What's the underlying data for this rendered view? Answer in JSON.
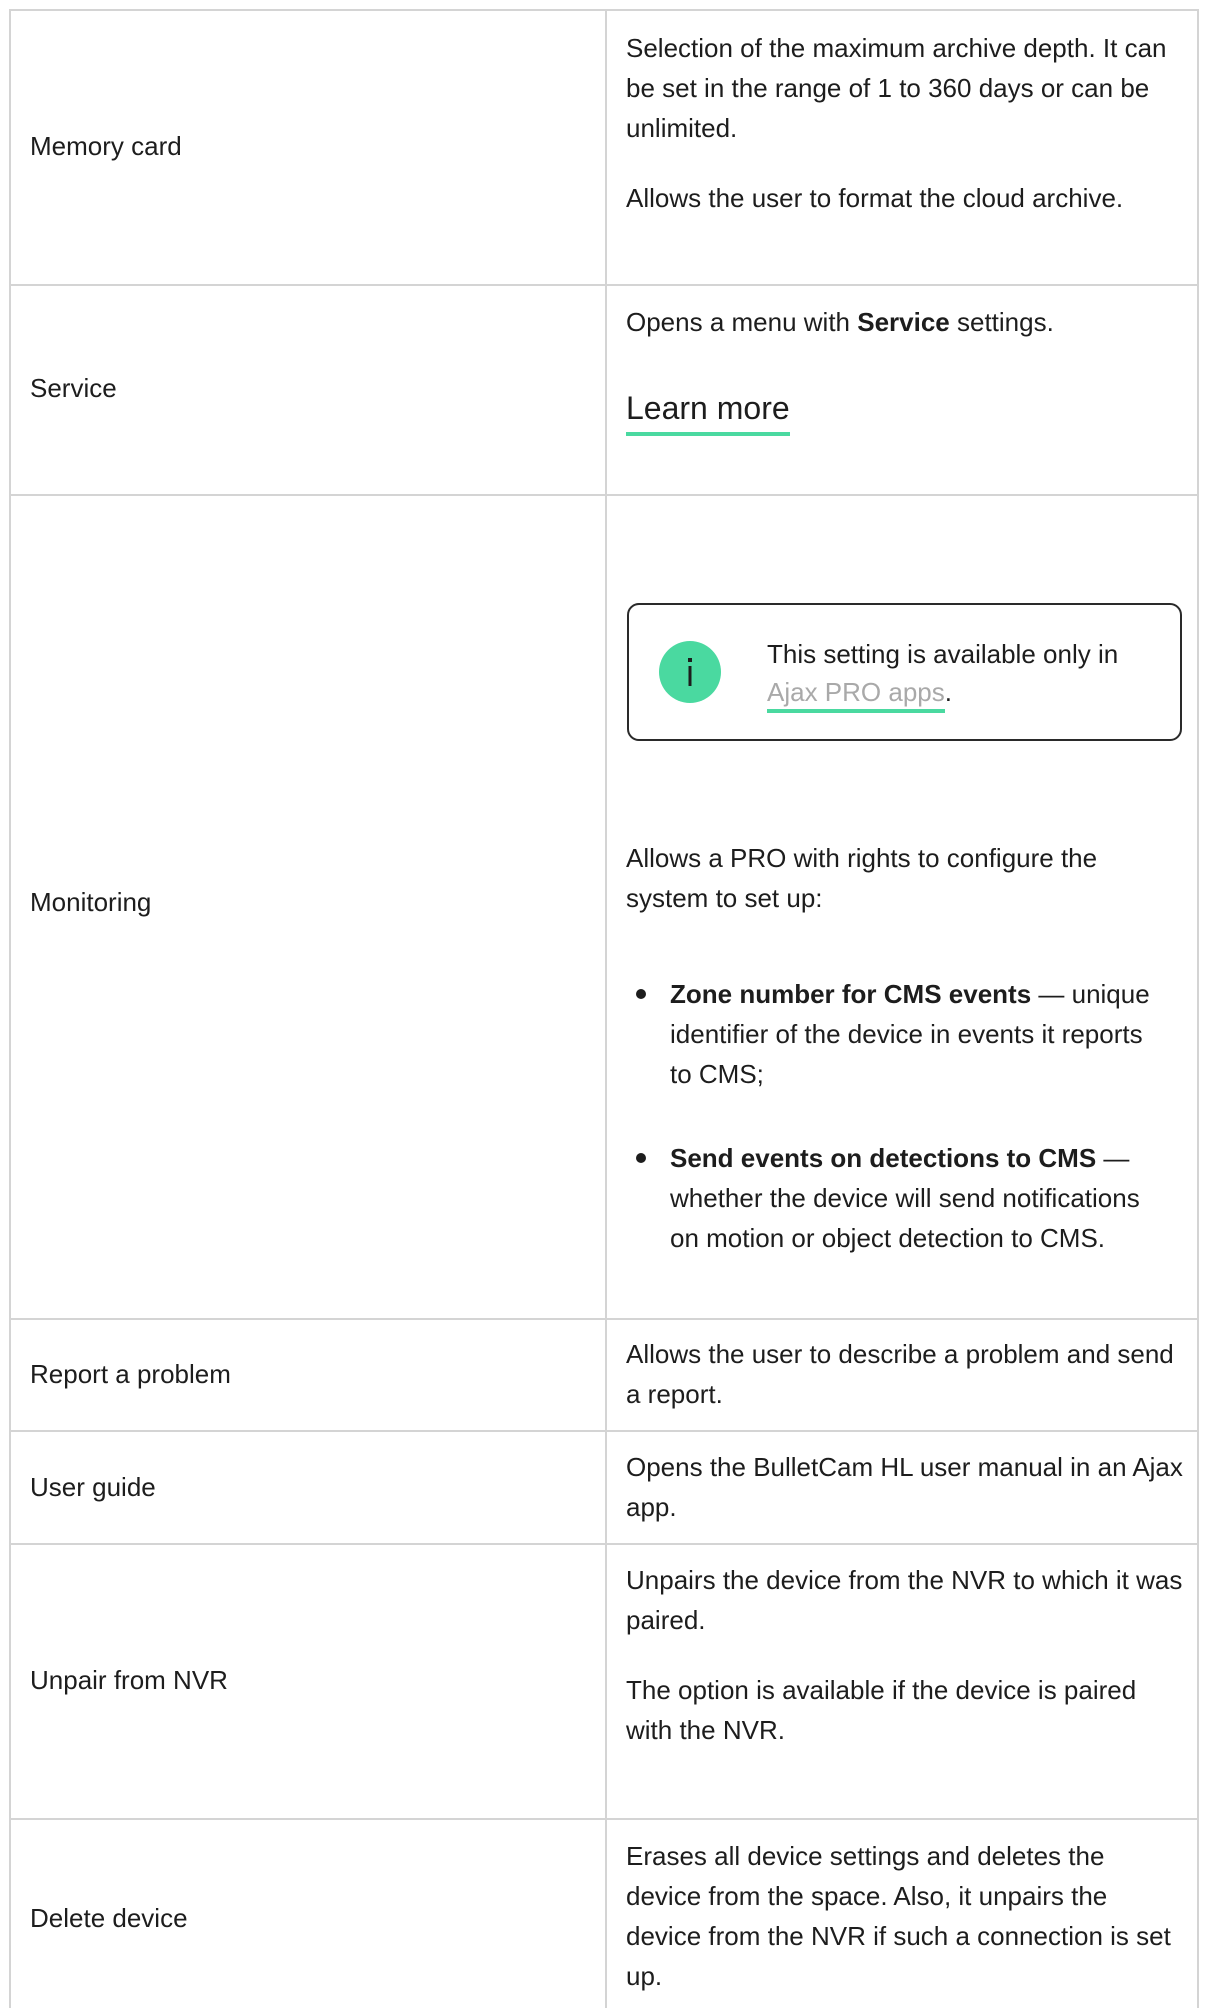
{
  "rows": [
    {
      "label": "Memory card",
      "description": [
        "Selection of the maximum archive depth. It can be set in the range of 1 to 360 days or can be unlimited.",
        "Allows the user to format the cloud archive."
      ]
    },
    {
      "label": "Service",
      "description_prefix": "Opens a menu with ",
      "description_bold": "Service",
      "description_suffix": " settings.",
      "link": "Learn more"
    },
    {
      "label": "Monitoring",
      "note": {
        "icon": "info-icon",
        "text_prefix": "This setting is available only in ",
        "link": "Ajax PRO apps",
        "text_suffix": "."
      },
      "intro": "Allows a PRO with rights to configure the system to set up:",
      "bullets": [
        {
          "bold": "Zone number for CMS events",
          "text": " — unique identifier of the device in events it reports to CMS;"
        },
        {
          "bold": "Send events on detections to CMS",
          "text": " — whether the device will send notifications on motion or object detection to CMS."
        }
      ]
    },
    {
      "label": "Report a problem",
      "description": [
        "Allows the user to describe a problem and send a report."
      ]
    },
    {
      "label": "User guide",
      "description": [
        "Opens the BulletCam HL user manual in an Ajax app."
      ]
    },
    {
      "label": "Unpair from NVR",
      "description": [
        "Unpairs the device from the NVR to which it was paired.",
        "The option is available if the device is paired with the NVR."
      ]
    },
    {
      "label": "Delete device",
      "description": [
        "Erases all device settings and deletes the device from the space. Also, it unpairs the device from the NVR if such a connection is set up."
      ]
    }
  ],
  "colors": {
    "accent": "#4ad9a0",
    "border": "#d4d4d4",
    "text": "#1d1d1d",
    "link_muted": "#a9a9a9"
  }
}
